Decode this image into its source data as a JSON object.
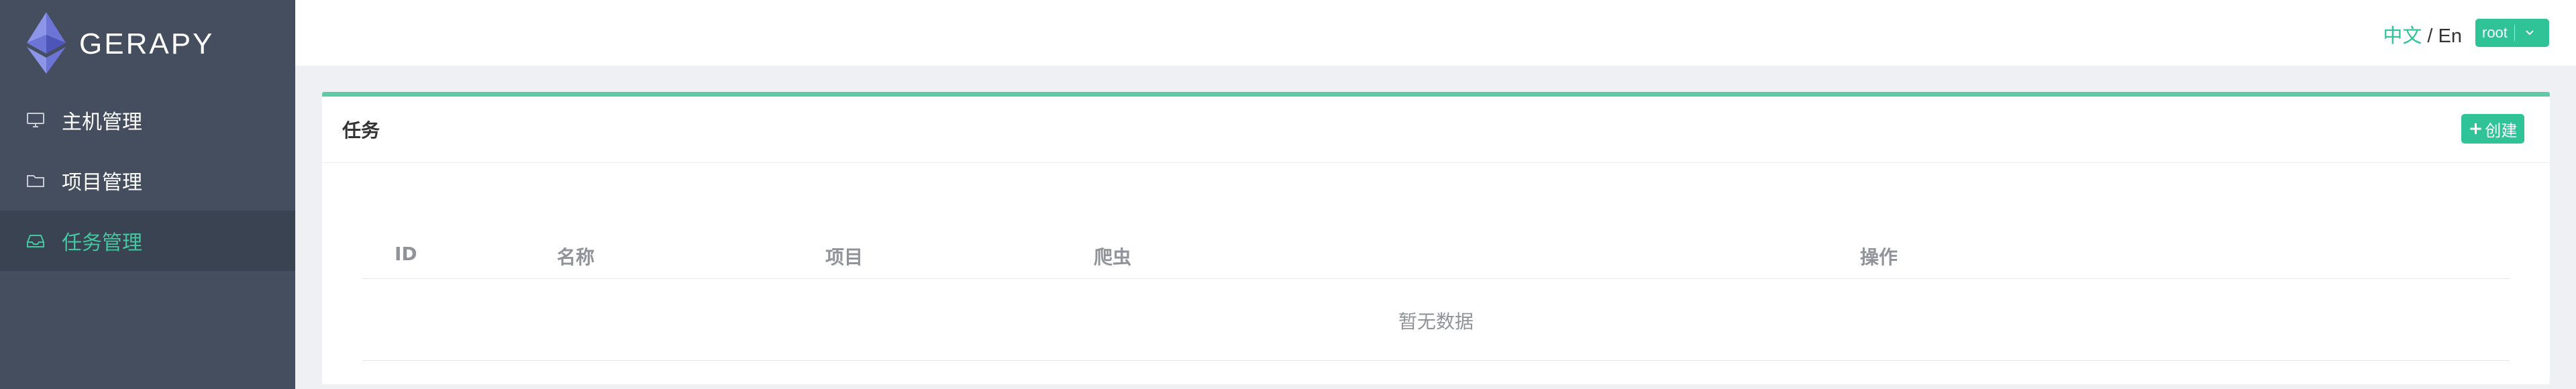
{
  "brand": {
    "title": "GERAPY",
    "logo_icon": "ethereum-diamond-logo"
  },
  "sidebar": {
    "items": [
      {
        "label": "主机管理",
        "icon": "monitor-icon",
        "active": false
      },
      {
        "label": "项目管理",
        "icon": "folder-icon",
        "active": false
      },
      {
        "label": "任务管理",
        "icon": "inbox-icon",
        "active": true
      }
    ]
  },
  "header": {
    "lang_zh": "中文",
    "lang_sep": " / ",
    "lang_en": "En",
    "user": "root",
    "user_icon": "chevron-down-icon"
  },
  "card": {
    "title": "任务",
    "create_label": "创建",
    "create_icon": "plus-icon"
  },
  "table": {
    "columns": [
      "ID",
      "名称",
      "项目",
      "爬虫",
      "操作"
    ],
    "rows": [],
    "empty_text": "暂无数据"
  },
  "colors": {
    "accent": "#2fc397",
    "sidebar_bg": "#444e5e",
    "sidebar_active_bg": "#394352",
    "page_bg": "#eef0f4"
  }
}
